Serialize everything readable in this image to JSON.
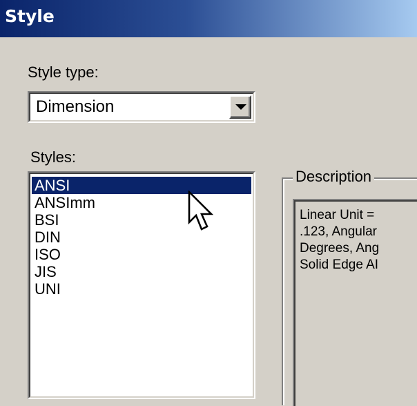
{
  "window": {
    "title": "Style"
  },
  "style_type": {
    "label": "Style type:",
    "selected": "Dimension"
  },
  "styles": {
    "label": "Styles:",
    "items": [
      "ANSI",
      "ANSImm",
      "BSI",
      "DIN",
      "ISO",
      "JIS",
      "UNI"
    ],
    "selected_index": 0
  },
  "description": {
    "legend": "Description",
    "lines": [
      "Linear Unit =",
      ".123, Angular",
      "Degrees, Ang",
      "Solid Edge AI"
    ]
  },
  "colors": {
    "selection": "#0a246a",
    "dialog_bg": "#d4d0c8"
  },
  "icons": {
    "dropdown": "chevron-down-icon",
    "pointer": "mouse-pointer-icon"
  }
}
